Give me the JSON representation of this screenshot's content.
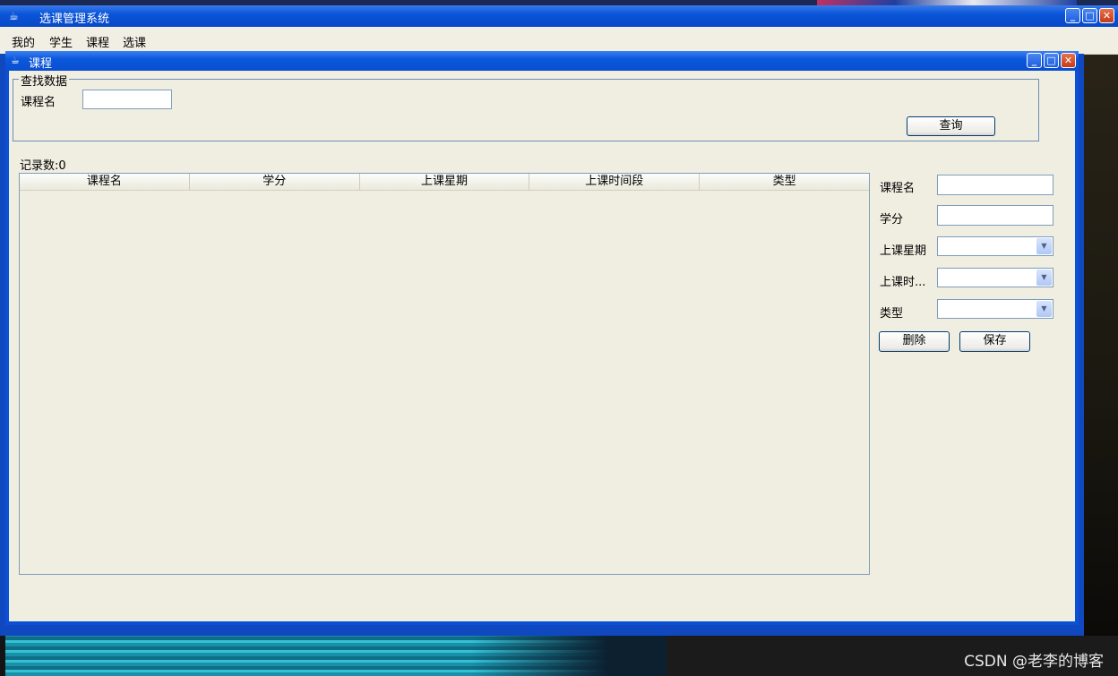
{
  "window": {
    "title": "选课管理系统"
  },
  "menu": [
    "我的",
    "学生",
    "课程",
    "选课"
  ],
  "course_window": {
    "title": "课程",
    "search_group": {
      "legend": "查找数据",
      "course_name_label": "课程名",
      "course_name_value": "",
      "query_button": "查询"
    },
    "record_count": "记录数:0",
    "table": {
      "columns": [
        "课程名",
        "学分",
        "上课星期",
        "上课时间段",
        "类型"
      ],
      "rows": []
    },
    "form": {
      "course_name_label": "课程名",
      "credit_label": "学分",
      "weekday_label": "上课星期",
      "time_label": "上课时...",
      "type_label": "类型",
      "delete_button": "删除",
      "save_button": "保存"
    }
  },
  "watermark": "CSDN @老李的博客"
}
